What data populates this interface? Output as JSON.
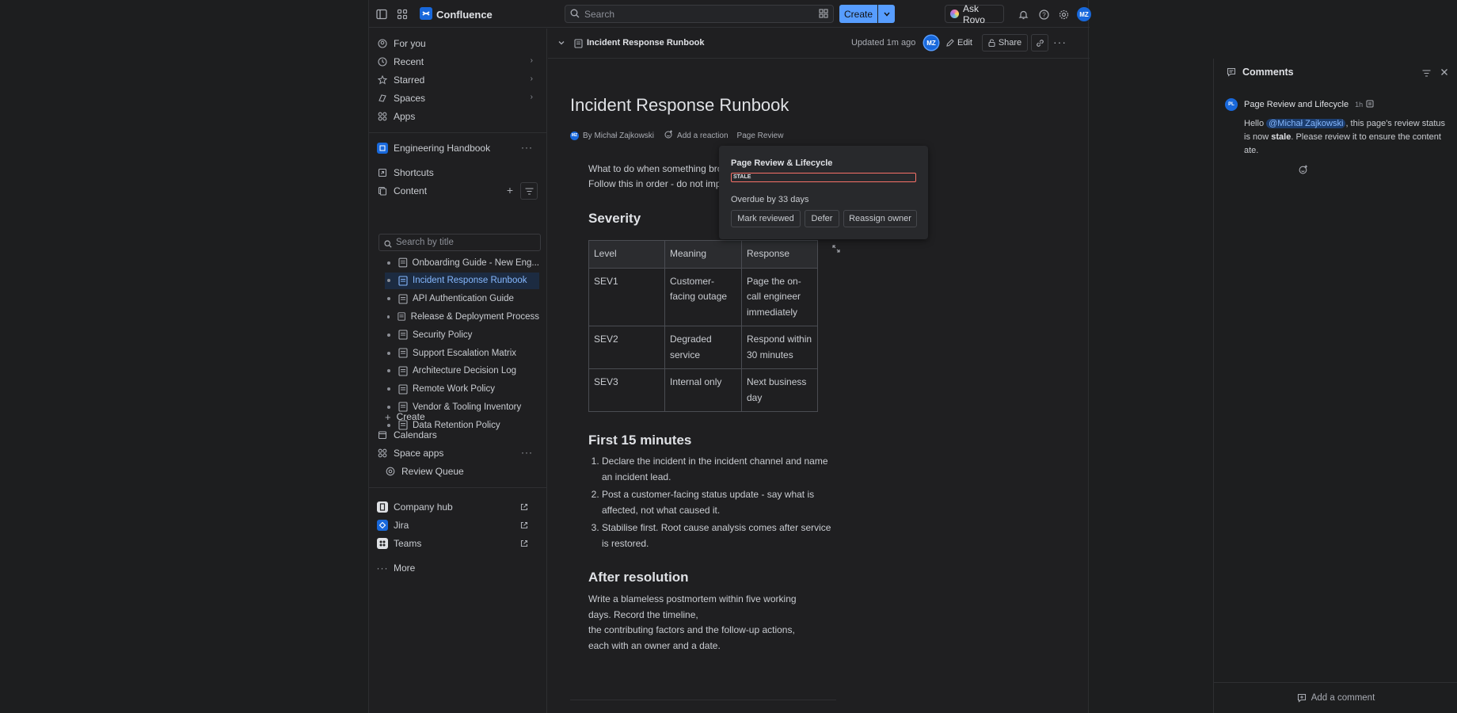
{
  "topbar": {
    "brand": "Confluence",
    "search_placeholder": "Search",
    "create_label": "Create",
    "ask_rovo_label": "Ask Rovo",
    "avatar_initials": "MZ"
  },
  "sidebar": {
    "nav": [
      {
        "label": "For you"
      },
      {
        "label": "Recent"
      },
      {
        "label": "Starred"
      },
      {
        "label": "Spaces"
      },
      {
        "label": "Apps"
      }
    ],
    "space_name": "Engineering Handbook",
    "shortcuts_label": "Shortcuts",
    "content_label": "Content",
    "search_placeholder": "Search by title",
    "pages": [
      {
        "label": "Onboarding Guide - New Eng..."
      },
      {
        "label": "Incident Response Runbook"
      },
      {
        "label": "API Authentication Guide"
      },
      {
        "label": "Release & Deployment Process"
      },
      {
        "label": "Security Policy"
      },
      {
        "label": "Support Escalation Matrix"
      },
      {
        "label": "Architecture Decision Log"
      },
      {
        "label": "Remote Work Policy"
      },
      {
        "label": "Vendor & Tooling Inventory"
      },
      {
        "label": "Data Retention Policy"
      }
    ],
    "create_label": "Create",
    "calendars_label": "Calendars",
    "space_apps_label": "Space apps",
    "review_queue_label": "Review Queue",
    "links": [
      {
        "label": "Company hub"
      },
      {
        "label": "Jira"
      },
      {
        "label": "Teams"
      }
    ],
    "more_label": "More"
  },
  "page": {
    "breadcrumb_title": "Incident Response Runbook",
    "updated": "Updated 1m ago",
    "author_initials": "MZ",
    "edit_label": "Edit",
    "share_label": "Share",
    "title": "Incident Response Runbook",
    "byline": "By Michał Zajkowski",
    "add_reaction": "Add a reaction",
    "page_review": "Page Review",
    "intro_line1": "What to do when something bro",
    "intro_line2": "Follow this in order - do not imp",
    "severity_heading": "Severity",
    "table": {
      "headers": [
        "Level",
        "Meaning",
        "Response"
      ],
      "rows": [
        [
          "SEV1",
          "Customer-facing outage",
          "Page the on-call engineer immediately"
        ],
        [
          "SEV2",
          "Degraded service",
          "Respond within 30 minutes"
        ],
        [
          "SEV3",
          "Internal only",
          "Next business day"
        ]
      ]
    },
    "first15_heading": "First 15 minutes",
    "steps": [
      "Declare the incident in the incident channel and name an incident lead.",
      "Post a customer-facing status update - say what is affected, not what caused it.",
      "Stabilise first. Root cause analysis comes after service is restored."
    ],
    "after_heading": "After resolution",
    "after_line1": "Write a blameless postmortem within five working days. Record the timeline,",
    "after_line2": "the contributing factors and the follow-up actions, each with an owner and a date."
  },
  "popup": {
    "title": "Page Review & Lifecycle",
    "status": "STALE",
    "overdue": "Overdue by 33 days",
    "mark_reviewed": "Mark reviewed",
    "defer": "Defer",
    "reassign": "Reassign owner"
  },
  "comments": {
    "header": "Comments",
    "author": "Page Review and Lifecycle",
    "author_initials": "PL",
    "time": "1h",
    "hello": "Hello",
    "mention": "@Michał Zajkowski",
    "text_a": ", this page's review status is now",
    "stale": "stale",
    "text_b": ". Please review it to ensure the content",
    "text_c": "ate.",
    "add_comment": "Add a comment"
  },
  "colors": {
    "accent": "#579dff",
    "stale_border": "#f87168",
    "active_bg": "#1c2b41"
  }
}
